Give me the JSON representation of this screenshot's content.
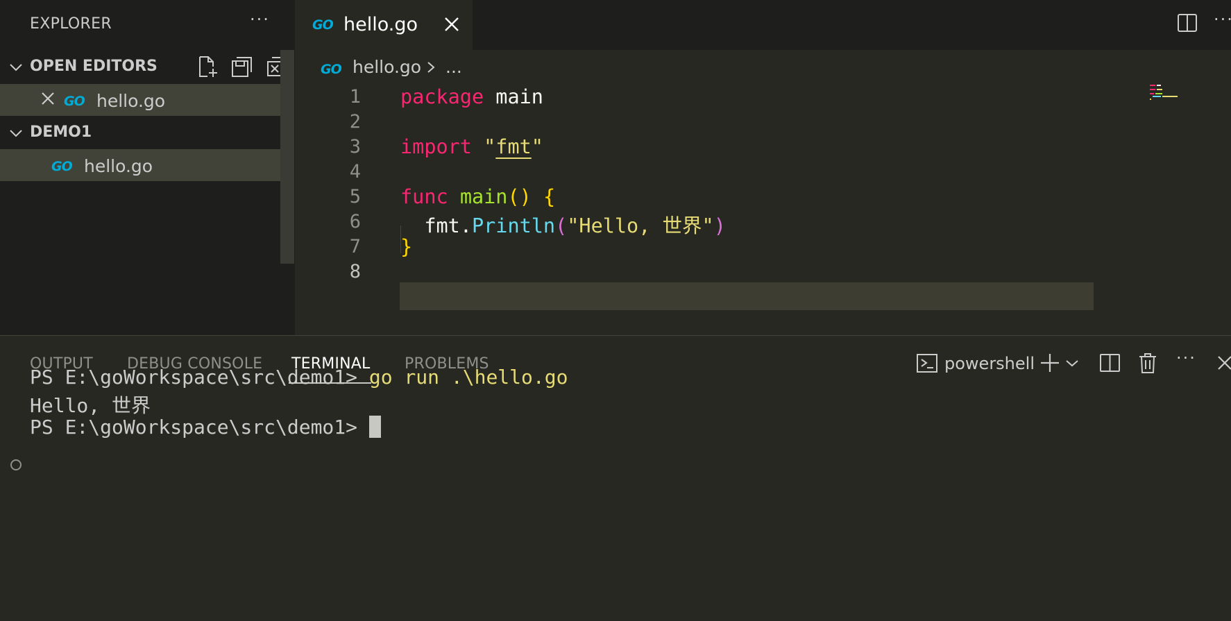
{
  "sidebar": {
    "title": "EXPLORER",
    "more": "···",
    "open_editors": {
      "label": "OPEN EDITORS",
      "files": [
        {
          "name": "hello.go",
          "logo": "GO"
        }
      ]
    },
    "folder": {
      "label": "DEMO1",
      "files": [
        {
          "name": "hello.go",
          "logo": "GO"
        }
      ]
    }
  },
  "tabs": [
    {
      "label": "hello.go",
      "logo": "GO"
    }
  ],
  "editor": {
    "more": "···",
    "breadcrumb": {
      "file": "hello.go",
      "logo": "GO",
      "ellipsis": "..."
    },
    "lines": [
      {
        "n": "1"
      },
      {
        "n": "2"
      },
      {
        "n": "3"
      },
      {
        "n": "4"
      },
      {
        "n": "5"
      },
      {
        "n": "6"
      },
      {
        "n": "7"
      },
      {
        "n": "8"
      }
    ],
    "code": {
      "l1_kw": "package",
      "l1_name": "main",
      "l3_kw": "import",
      "l3_q1": "\"",
      "l3_pkg": "fmt",
      "l3_q2": "\"",
      "l5_kw": "func",
      "l5_name": "main",
      "l5_parens": "()",
      "l5_brace": "{",
      "l6_obj": "fmt",
      "l6_dot": ".",
      "l6_fn": "Println",
      "l6_open": "(",
      "l6_str": "\"Hello, 世界\"",
      "l6_close": ")",
      "l7_brace": "}"
    }
  },
  "panel": {
    "tabs": [
      "OUTPUT",
      "DEBUG CONSOLE",
      "TERMINAL",
      "PROBLEMS"
    ],
    "active_tab": "TERMINAL",
    "shell": "powershell",
    "more": "···",
    "terminal": {
      "prompt": "PS E:\\goWorkspace\\src\\demo1>",
      "command": "go run .\\hello.go",
      "output": "Hello, 世界"
    }
  },
  "colors": {
    "background": "#272822",
    "sidebar": "#1e1f1c",
    "keyword": "#f92672",
    "function": "#a6e22e",
    "string": "#e6db74",
    "go_brand": "#00acd7"
  }
}
